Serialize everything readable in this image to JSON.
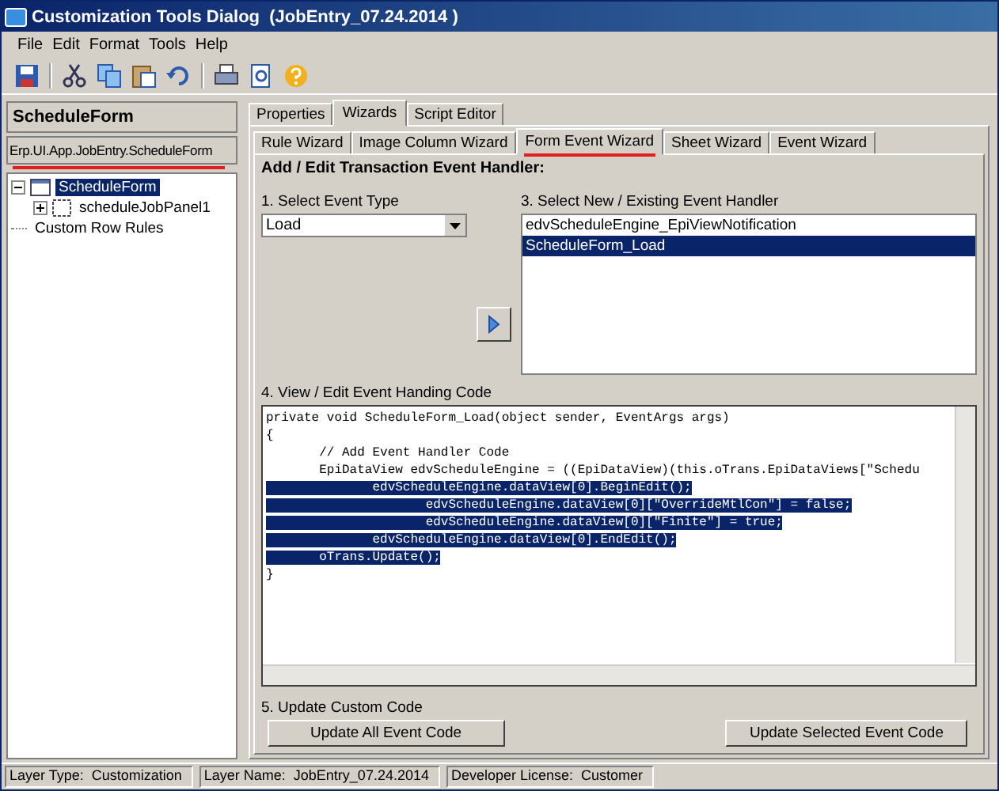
{
  "window": {
    "title": "Customization Tools Dialog  (JobEntry_07.24.2014 )"
  },
  "menu": [
    "File",
    "Edit",
    "Format",
    "Tools",
    "Help"
  ],
  "left_panel": {
    "title": "ScheduleForm",
    "path": "Erp.UI.App.JobEntry.ScheduleForm",
    "tree": [
      {
        "label": "ScheduleForm",
        "selected": true,
        "expanded": true,
        "children": [
          {
            "label": "scheduleJobPanel1",
            "selected": false,
            "expanded": false
          }
        ]
      },
      {
        "label": "Custom Row Rules",
        "selected": false
      }
    ]
  },
  "tabs": [
    {
      "label": "Properties",
      "selected": false
    },
    {
      "label": "Wizards",
      "selected": true
    },
    {
      "label": "Script Editor",
      "selected": false
    }
  ],
  "wizard_tabs": [
    {
      "label": "Rule Wizard",
      "selected": false
    },
    {
      "label": "Image Column Wizard",
      "selected": false
    },
    {
      "label": "Form Event Wizard",
      "selected": true
    },
    {
      "label": "Sheet Wizard",
      "selected": false
    },
    {
      "label": "Event Wizard",
      "selected": false
    }
  ],
  "heading": "Add / Edit Transaction Event Handler:",
  "event_type": {
    "label": "1. Select Event Type",
    "value": "Load"
  },
  "handlers": {
    "label": "3. Select New / Existing Event Handler",
    "items": [
      {
        "label": "edvScheduleEngine_EpiViewNotification",
        "selected": false
      },
      {
        "label": "ScheduleForm_Load",
        "selected": true
      }
    ]
  },
  "code": {
    "label": "4. View / Edit Event Handing Code",
    "lines": [
      {
        "text": "private void ScheduleForm_Load(object sender, EventArgs args)",
        "selected": false
      },
      {
        "text": "{",
        "selected": false
      },
      {
        "text": "       // Add Event Handler Code",
        "selected": false
      },
      {
        "text": "       EpiDataView edvScheduleEngine = ((EpiDataView)(this.oTrans.EpiDataViews[\"Schedu",
        "selected": false
      },
      {
        "text": "              edvScheduleEngine.dataView[0].BeginEdit();",
        "selected": true
      },
      {
        "text": "                     edvScheduleEngine.dataView[0][\"OverrideMtlCon\"] = false;",
        "selected": true
      },
      {
        "text": "                     edvScheduleEngine.dataView[0][\"Finite\"] = true;",
        "selected": true
      },
      {
        "text": "              edvScheduleEngine.dataView[0].EndEdit();",
        "selected": true
      },
      {
        "text": "       oTrans.Update();",
        "selected": true
      },
      {
        "text": "}",
        "selected": false
      }
    ]
  },
  "update": {
    "label": "5. Update Custom Code",
    "buttons": [
      "Update All Event Code",
      "Update Selected Event Code"
    ]
  },
  "status_bar": [
    "Layer Type:  Customization",
    "Layer Name:  JobEntry_07.24.2014",
    "Developer License:  Customer"
  ]
}
